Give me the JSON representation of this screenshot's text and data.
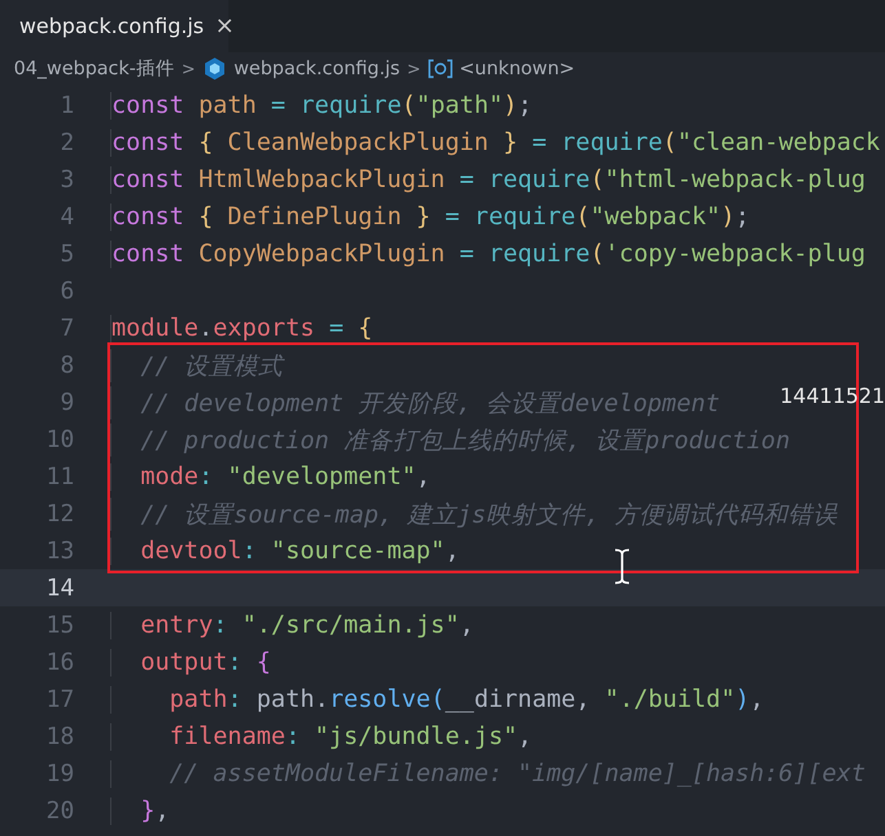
{
  "tabs": [
    {
      "label": "webpack.config.js",
      "selected": true,
      "close": "×"
    }
  ],
  "breadcrumbs": [
    {
      "kind": "folder",
      "text": "04_webpack-插件"
    },
    {
      "kind": "file",
      "separator": ">",
      "text": "webpack.config.js"
    },
    {
      "kind": "symbol",
      "separator": ">",
      "text": "<unknown>"
    }
  ],
  "overlay_text": "14411521",
  "lines": [
    {
      "number": "1",
      "current": false,
      "boxed": false,
      "tokens": [
        {
          "kind": "keyword",
          "text": "const "
        },
        {
          "kind": "variable",
          "text": "path"
        },
        {
          "kind": "op",
          "text": " = "
        },
        {
          "kind": "func",
          "text": "require"
        },
        {
          "kind": "brace",
          "text": "("
        },
        {
          "kind": "string",
          "text": "\"path\""
        },
        {
          "kind": "brace",
          "text": ")"
        },
        {
          "kind": "punct",
          "text": ";"
        }
      ]
    },
    {
      "number": "2",
      "current": false,
      "boxed": false,
      "tokens": [
        {
          "kind": "keyword",
          "text": "const "
        },
        {
          "kind": "brace",
          "text": "{ "
        },
        {
          "kind": "variable",
          "text": "CleanWebpackPlugin"
        },
        {
          "kind": "brace",
          "text": " }"
        },
        {
          "kind": "op",
          "text": " = "
        },
        {
          "kind": "func",
          "text": "require"
        },
        {
          "kind": "brace",
          "text": "("
        },
        {
          "kind": "string",
          "text": "\"clean-webpack"
        }
      ]
    },
    {
      "number": "3",
      "current": false,
      "boxed": false,
      "tokens": [
        {
          "kind": "keyword",
          "text": "const "
        },
        {
          "kind": "variable",
          "text": "HtmlWebpackPlugin"
        },
        {
          "kind": "op",
          "text": " = "
        },
        {
          "kind": "func",
          "text": "require"
        },
        {
          "kind": "brace",
          "text": "("
        },
        {
          "kind": "string",
          "text": "\"html-webpack-plug"
        }
      ]
    },
    {
      "number": "4",
      "current": false,
      "boxed": false,
      "tokens": [
        {
          "kind": "keyword",
          "text": "const "
        },
        {
          "kind": "brace",
          "text": "{ "
        },
        {
          "kind": "variable",
          "text": "DefinePlugin"
        },
        {
          "kind": "brace",
          "text": " }"
        },
        {
          "kind": "op",
          "text": " = "
        },
        {
          "kind": "func",
          "text": "require"
        },
        {
          "kind": "brace",
          "text": "("
        },
        {
          "kind": "string",
          "text": "\"webpack\""
        },
        {
          "kind": "brace",
          "text": ")"
        },
        {
          "kind": "punct",
          "text": ";"
        }
      ]
    },
    {
      "number": "5",
      "current": false,
      "boxed": false,
      "tokens": [
        {
          "kind": "keyword",
          "text": "const "
        },
        {
          "kind": "variable",
          "text": "CopyWebpackPlugin"
        },
        {
          "kind": "op",
          "text": " = "
        },
        {
          "kind": "func",
          "text": "require"
        },
        {
          "kind": "brace",
          "text": "("
        },
        {
          "kind": "string",
          "text": "'copy-webpack-plug"
        }
      ]
    },
    {
      "number": "6",
      "current": false,
      "boxed": false
    },
    {
      "number": "7",
      "current": false,
      "boxed": false,
      "tokens": [
        {
          "kind": "property",
          "text": "module"
        },
        {
          "kind": "punct",
          "text": "."
        },
        {
          "kind": "property",
          "text": "exports"
        },
        {
          "kind": "op",
          "text": " = "
        },
        {
          "kind": "brace",
          "text": "{"
        }
      ]
    },
    {
      "number": "8",
      "current": false,
      "boxed": true,
      "tokens": [
        {
          "kind": "comment",
          "text": "  // 设置模式"
        }
      ]
    },
    {
      "number": "9",
      "current": false,
      "boxed": true,
      "tokens": [
        {
          "kind": "comment",
          "text": "  // development 开发阶段, 会设置development"
        }
      ]
    },
    {
      "number": "10",
      "current": false,
      "boxed": true,
      "tokens": [
        {
          "kind": "comment",
          "text": "  // production 准备打包上线的时候, 设置production"
        }
      ]
    },
    {
      "number": "11",
      "current": false,
      "boxed": true,
      "tokens": [
        {
          "kind": "property",
          "text": "  mode"
        },
        {
          "kind": "op",
          "text": ": "
        },
        {
          "kind": "string",
          "text": "\"development\""
        },
        {
          "kind": "punct",
          "text": ","
        }
      ]
    },
    {
      "number": "12",
      "current": false,
      "boxed": true,
      "tokens": [
        {
          "kind": "comment",
          "text": "  // 设置source-map, 建立js映射文件, 方便调试代码和错误"
        }
      ]
    },
    {
      "number": "13",
      "current": false,
      "boxed": true,
      "tokens": [
        {
          "kind": "property",
          "text": "  devtool"
        },
        {
          "kind": "op",
          "text": ": "
        },
        {
          "kind": "string",
          "text": "\"source-map\""
        },
        {
          "kind": "punct",
          "text": ","
        }
      ]
    },
    {
      "number": "14",
      "current": true,
      "boxed": false
    },
    {
      "number": "15",
      "current": false,
      "boxed": false,
      "tokens": [
        {
          "kind": "property",
          "text": "  entry"
        },
        {
          "kind": "op",
          "text": ": "
        },
        {
          "kind": "string",
          "text": "\"./src/main.js\""
        },
        {
          "kind": "punct",
          "text": ","
        }
      ]
    },
    {
      "number": "16",
      "current": false,
      "boxed": false,
      "tokens": [
        {
          "kind": "property",
          "text": "  output"
        },
        {
          "kind": "op",
          "text": ": "
        },
        {
          "kind": "keyword",
          "text": "{"
        }
      ]
    },
    {
      "number": "17",
      "current": false,
      "boxed": false,
      "tokens": [
        {
          "kind": "property",
          "text": "    path"
        },
        {
          "kind": "op",
          "text": ": "
        },
        {
          "kind": "plain",
          "text": "path."
        },
        {
          "kind": "method",
          "text": "resolve"
        },
        {
          "kind": "method",
          "text": "("
        },
        {
          "kind": "plain",
          "text": "__dirname, "
        },
        {
          "kind": "string",
          "text": "\"./build\""
        },
        {
          "kind": "method",
          "text": ")"
        },
        {
          "kind": "punct",
          "text": ","
        }
      ]
    },
    {
      "number": "18",
      "current": false,
      "boxed": false,
      "tokens": [
        {
          "kind": "property",
          "text": "    filename"
        },
        {
          "kind": "op",
          "text": ": "
        },
        {
          "kind": "string",
          "text": "\"js/bundle.js\""
        },
        {
          "kind": "punct",
          "text": ","
        }
      ]
    },
    {
      "number": "19",
      "current": false,
      "boxed": false,
      "tokens": [
        {
          "kind": "comment",
          "text": "    // assetModuleFilename: \"img/[name]_[hash:6][ext"
        }
      ]
    },
    {
      "number": "20",
      "current": false,
      "boxed": false,
      "tokens": [
        {
          "kind": "keyword",
          "text": "  }"
        },
        {
          "kind": "punct",
          "text": ","
        }
      ]
    }
  ]
}
